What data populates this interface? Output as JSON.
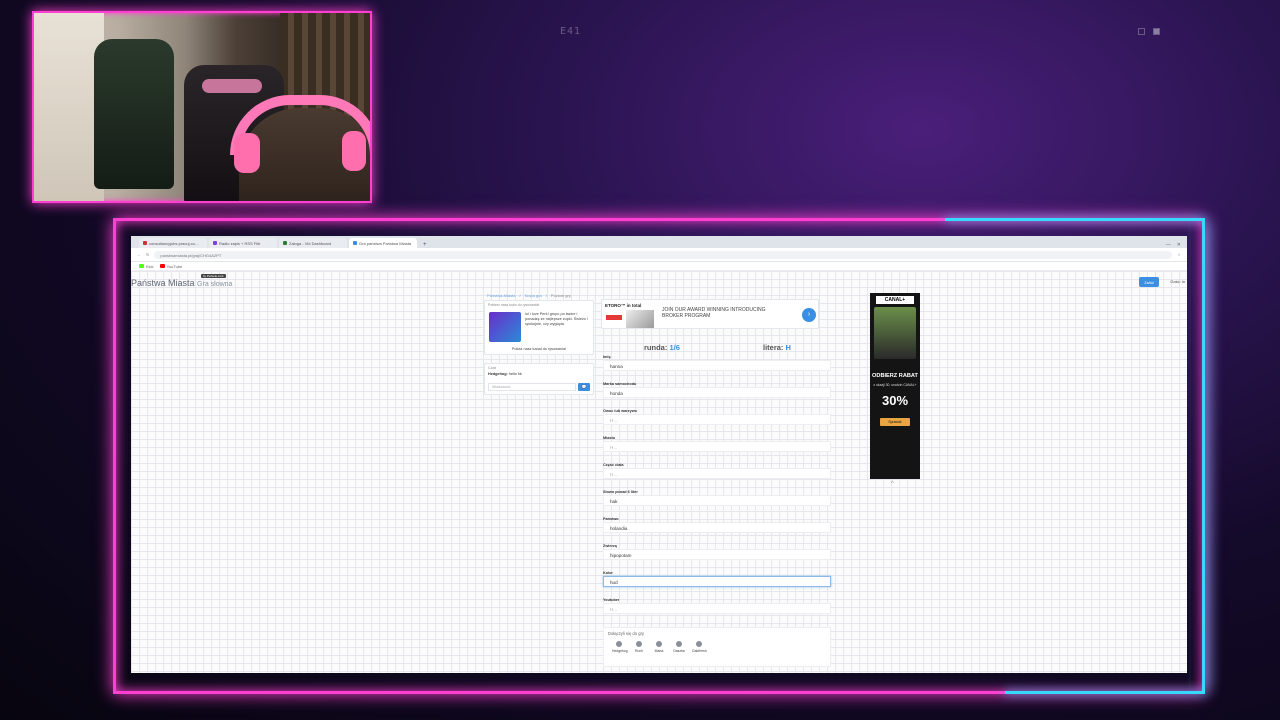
{
  "overlay": {
    "code": "E41"
  },
  "browser": {
    "tabs": [
      {
        "label": "consultancyjobs.pracuj.co…"
      },
      {
        "label": "Radio zapis + RSS Filtr"
      },
      {
        "label": "Zaloga - Vid Dashboard"
      },
      {
        "label": "Gra państwa Państwa Miasta"
      }
    ],
    "new_tab": "+",
    "url": "panstwamiasta.pl/graj/CHG4A2PT",
    "bookmarks": [
      "Kick",
      "YouTube"
    ]
  },
  "site": {
    "brand": "Państwa Miasta",
    "brand_sub": "Gra słowna",
    "beta": "by Perkele.Link",
    "join_label": "Załóż",
    "guest_label": "Gość: ln"
  },
  "breadcrumbs": [
    "Państwa-Miasta",
    "Nowa gra",
    "Poziom gry"
  ],
  "promo": {
    "header": "Pobierz nasz kolor do rysowania!",
    "text": "lol i love Perk! grupo po łazice i ponadzę ze najlepsze zupki. Świeżo i spokojnie, czy wygląda",
    "link": "Pokaż nasz kanał do rysowania!"
  },
  "chat": {
    "header": "Czat",
    "author": "Hedgehog:",
    "message": "hello kk",
    "placeholder": "Wiadomość",
    "send_icon": "speech-bubble-icon"
  },
  "banner": {
    "logo": "ETORO™ in total",
    "copy": "JOIN OUR AWARD WINNING INTRODUCING BROKER PROGRAM",
    "arrow": "›"
  },
  "game": {
    "round_label": "runda:",
    "round_value": "1/6",
    "letter_label": "litera:",
    "letter_value": "H",
    "fields": [
      {
        "label": "Imię",
        "value": "hanna",
        "placeholder": ""
      },
      {
        "label": "Marka samochodu",
        "value": "honda",
        "placeholder": ""
      },
      {
        "label": "Owoc lub warzywo",
        "value": "",
        "placeholder": "H..."
      },
      {
        "label": "Miasto",
        "value": "",
        "placeholder": "H..."
      },
      {
        "label": "Część ciała",
        "value": "",
        "placeholder": "H..."
      },
      {
        "label": "Słowo ponad 6 liter",
        "value": "hak",
        "placeholder": ""
      },
      {
        "label": "Państwo",
        "value": "holandia",
        "placeholder": ""
      },
      {
        "label": "Zwierzę",
        "value": "hipopotam",
        "placeholder": ""
      },
      {
        "label": "Kolor",
        "value": "hud",
        "placeholder": ""
      },
      {
        "label": "Youtuber",
        "value": "",
        "placeholder": "H..."
      }
    ],
    "players_header": "Dołączyli się do gry",
    "players": [
      "Hedgehog",
      "Ruch",
      "Marta",
      "Daszka",
      "Gabifresh"
    ]
  },
  "ad": {
    "brand": "CANAL+",
    "headline": "ODBIERZ RABAT",
    "sub": "z okazji 30. urodzin CANAL+",
    "percent": "30%",
    "cta": "Sprawdź",
    "up_icon": "^"
  }
}
